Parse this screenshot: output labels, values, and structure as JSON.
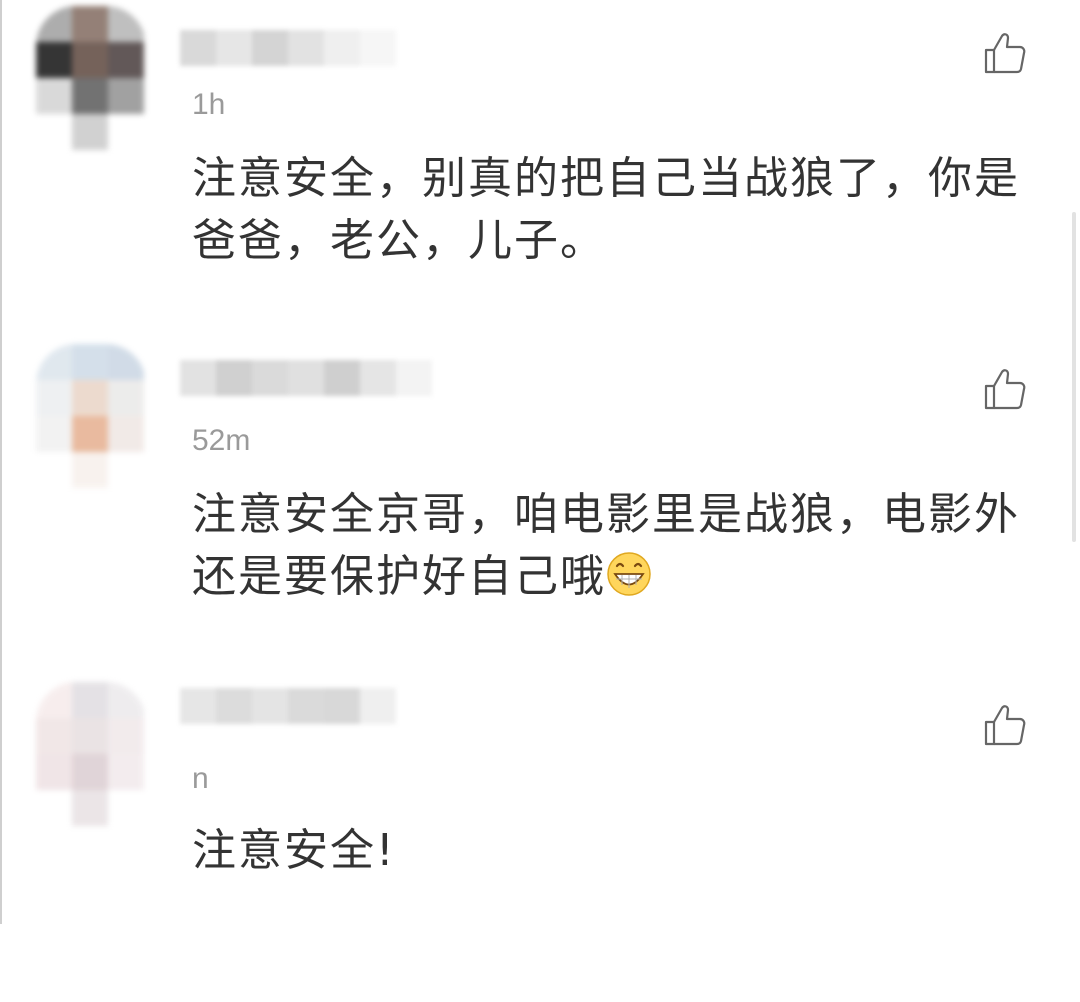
{
  "comments": [
    {
      "time": "1h",
      "text": "注意安全，别真的把自己当战狼了，你是爸爸，老公，儿子。",
      "like_icon": "thumbs-up-icon",
      "avatar_colors": [
        "#a9a9a9",
        "#8f7a70",
        "#bcbcbc",
        "#2b2b2b",
        "#6e5a52",
        "#5a5050",
        "#d8d8d8",
        "#6b6b6b",
        "#9c9c9c",
        "#ffffff",
        "#cfcfcf",
        "#ffffff"
      ],
      "name_colors": [
        "#d9d9d9",
        "#e6e6e6",
        "#d4d4d4",
        "#e2e2e2",
        "#efefef",
        "#f6f6f6"
      ]
    },
    {
      "time": "52m",
      "text": "注意安全京哥，咱电影里是战狼，电影外还是要保护好自己哦",
      "emoji": "grinning-face-emoji",
      "like_icon": "thumbs-up-icon",
      "avatar_colors": [
        "#dfe7ee",
        "#d2dee9",
        "#cfdae6",
        "#eef0f2",
        "#ecd9cc",
        "#ecebea",
        "#f2f2f2",
        "#e8b79a",
        "#f1e9e6",
        "#ffffff",
        "#f8f2ee",
        "#ffffff"
      ],
      "name_colors": [
        "#e2e2e2",
        "#d0d0d0",
        "#dadada",
        "#e0e0e0",
        "#cfcfcf",
        "#e5e5e5",
        "#f3f3f3"
      ]
    },
    {
      "time": "n",
      "text": "注意安全!",
      "like_icon": "thumbs-up-icon",
      "avatar_colors": [
        "#f7eded",
        "#e3e0e4",
        "#eeecee",
        "#f1e6e6",
        "#e9e2e3",
        "#f2eaec",
        "#f0e4e6",
        "#dfd2d6",
        "#f3ecee",
        "#ffffff",
        "#eae4e6",
        "#ffffff"
      ],
      "name_colors": [
        "#e6e6e6",
        "#dcdcdc",
        "#e4e4e4",
        "#dadada",
        "#d8d8d8",
        "#efefef"
      ]
    }
  ]
}
